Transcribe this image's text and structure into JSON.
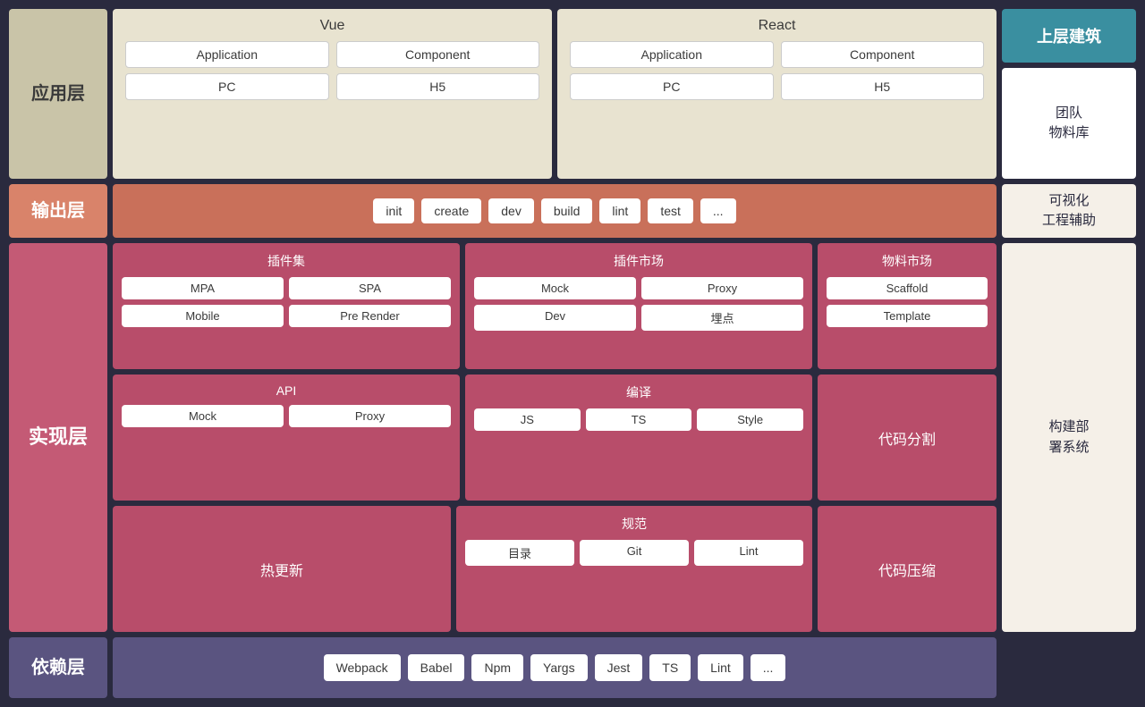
{
  "layers": {
    "app_label": "应用层",
    "output_label": "输出层",
    "impl_label": "实现层",
    "dep_label": "依赖层"
  },
  "vue": {
    "title": "Vue",
    "row1": [
      "Application",
      "Component"
    ],
    "row2": [
      "PC",
      "H5"
    ]
  },
  "react": {
    "title": "React",
    "row1": [
      "Application",
      "Component"
    ],
    "row2": [
      "PC",
      "H5"
    ]
  },
  "output": {
    "items": [
      "init",
      "create",
      "dev",
      "build",
      "lint",
      "test",
      "..."
    ]
  },
  "plugin_set": {
    "title": "插件集",
    "row1": [
      "MPA",
      "SPA"
    ],
    "row2": [
      "Mobile",
      "Pre Render"
    ]
  },
  "plugin_market": {
    "title": "插件市场",
    "row1": [
      "Mock",
      "Proxy"
    ],
    "row2": [
      "Dev",
      "埋点"
    ]
  },
  "material_market": {
    "title": "物料市场",
    "row1": [
      "Scaffold"
    ],
    "row2": [
      "Template"
    ]
  },
  "api": {
    "title": "API",
    "row1": [
      "Mock",
      "Proxy"
    ]
  },
  "compile": {
    "title": "编译",
    "row1": [
      "JS",
      "TS",
      "Style"
    ]
  },
  "code_split": {
    "label": "代码分割"
  },
  "hot_reload": {
    "label": "热更新"
  },
  "spec": {
    "title": "规范",
    "row1": [
      "目录",
      "Git",
      "Lint"
    ]
  },
  "code_compress": {
    "label": "代码压缩"
  },
  "deps": {
    "items": [
      "Webpack",
      "Babel",
      "Npm",
      "Yargs",
      "Jest",
      "TS",
      "Lint",
      "..."
    ]
  },
  "sidebar": {
    "header": "上层建筑",
    "items": [
      "团队\n物料库",
      "可视化\n工程辅助",
      "构建部\n署系统"
    ]
  }
}
